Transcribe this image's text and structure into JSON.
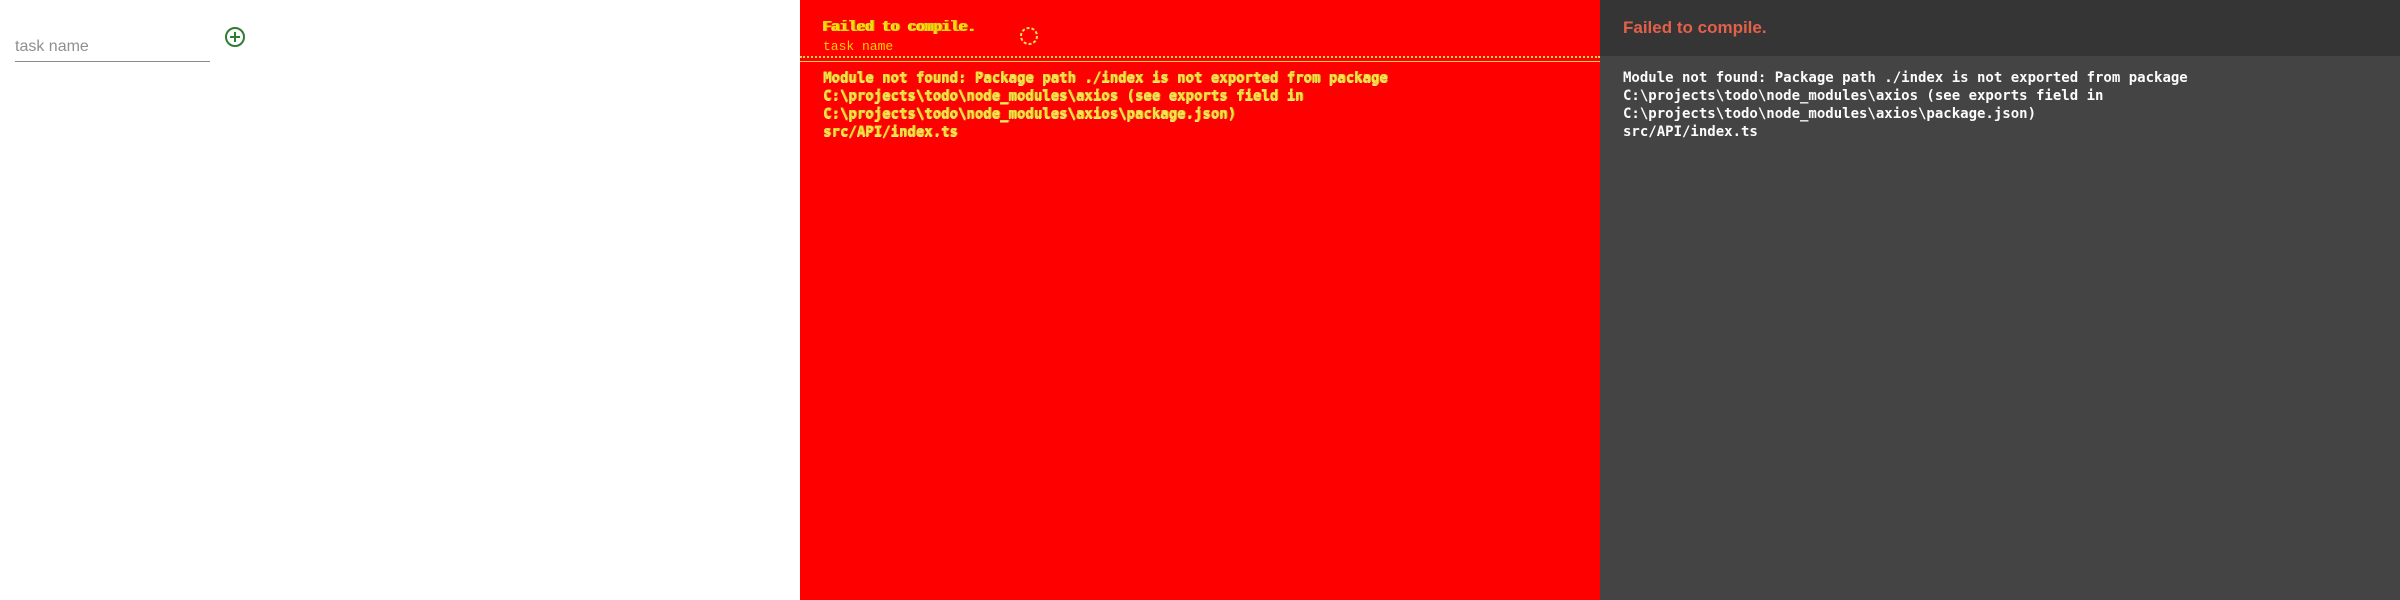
{
  "task_form": {
    "placeholder": "task name",
    "value": "",
    "add_icon": "plus-circle-icon",
    "accent_color": "#2e7d32"
  },
  "diff_overlay": {
    "title": "Failed to compile.",
    "subtitle": "task name",
    "spinner_icon": "spinner-icon",
    "message": "Module not found: Package path ./index is not exported from package\nC:\\projects\\todo\\node_modules\\axios (see exports field in\nC:\\projects\\todo\\node_modules\\axios\\package.json)\nsrc/API/index.ts",
    "background_color": "#ff0000",
    "text_color": "#f5e04c"
  },
  "error_overlay": {
    "title": "Failed to compile.",
    "message": "Module not found: Package path ./index is not exported from package\nC:\\projects\\todo\\node_modules\\axios (see exports field in\nC:\\projects\\todo\\node_modules\\axios\\package.json)\nsrc/API/index.ts",
    "title_color": "#e36049",
    "header_color": "#353535",
    "background_color": "#444444"
  }
}
